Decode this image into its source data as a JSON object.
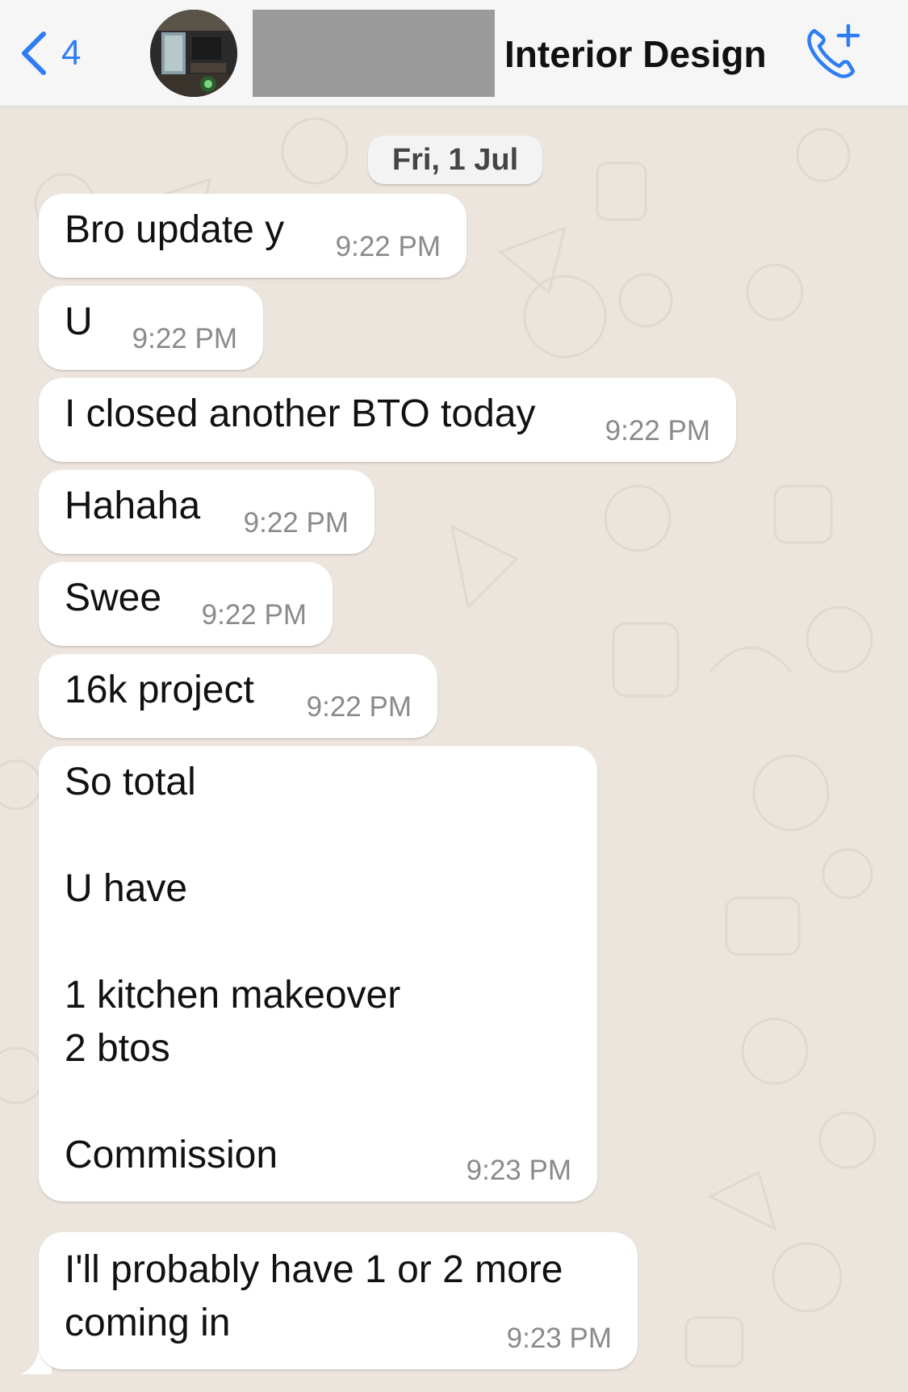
{
  "header": {
    "back_count": "4",
    "title": "Interior Design",
    "accent_color": "#2f7df6",
    "icons": {
      "back": "chevron-left-icon",
      "call": "add-call-icon"
    }
  },
  "chat": {
    "date_label": "Fri, 1 Jul",
    "messages": [
      {
        "text": "Bro update y",
        "time": "9:22 PM"
      },
      {
        "text": "U",
        "time": "9:22 PM"
      },
      {
        "text": "I closed another BTO today",
        "time": "9:22 PM"
      },
      {
        "text": "Hahaha",
        "time": "9:22 PM"
      },
      {
        "text": "Swee",
        "time": "9:22 PM"
      },
      {
        "text": "16k project",
        "time": "9:22 PM"
      },
      {
        "text": "So total\n\nU have\n\n1 kitchen makeover\n2 btos\n\nCommission",
        "time": "9:23 PM"
      },
      {
        "text": "I'll probably have 1 or 2 more\ncoming in",
        "time": "9:23 PM"
      }
    ]
  }
}
